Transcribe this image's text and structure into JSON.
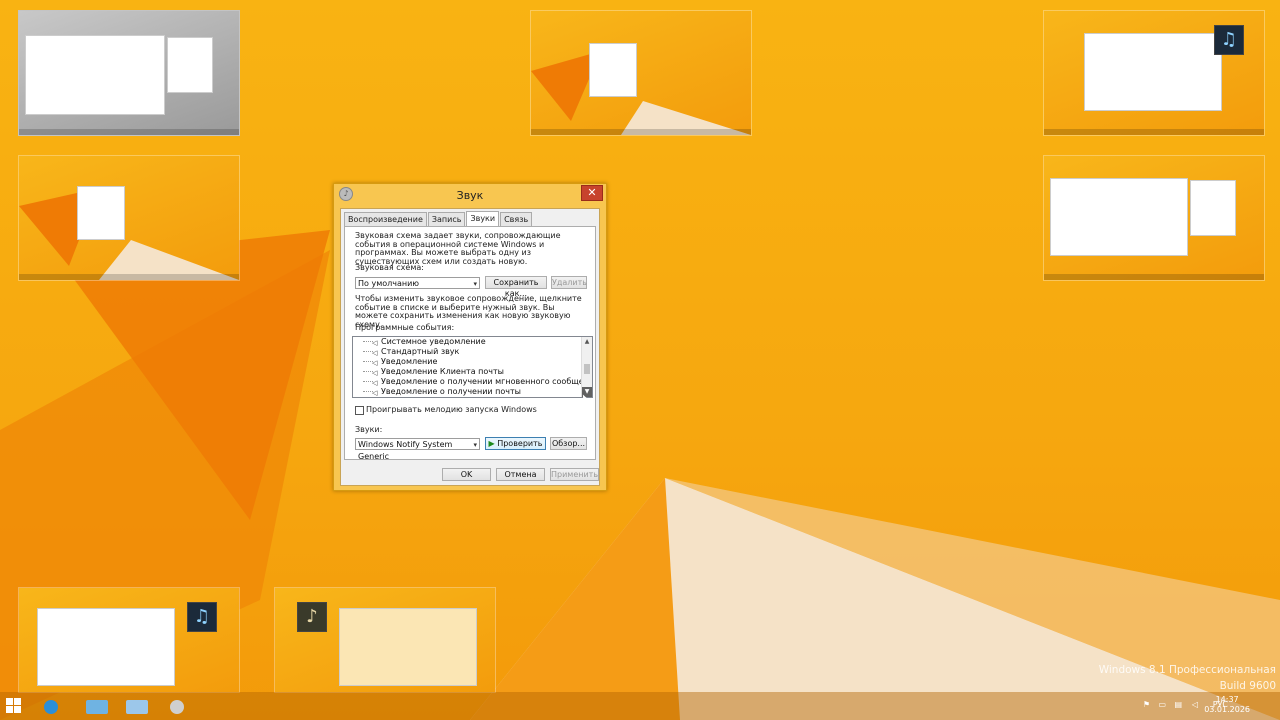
{
  "dialog": {
    "title": "Звук",
    "close_glyph": "✕",
    "tabs": [
      "Воспроизведение",
      "Запись",
      "Звуки",
      "Связь"
    ],
    "active_tab": "Звуки",
    "intro": "Звуковая схема задает звуки, сопровождающие события в операционной системе Windows и программах. Вы можете выбрать одну из существующих схем или создать новую.",
    "scheme_label": "Звуковая схема:",
    "scheme_value": "По умолчанию",
    "save_as": "Сохранить как...",
    "delete": "Удалить",
    "instruction": "Чтобы изменить звуковое сопровождение, щелкните событие в списке и выберите нужный звук. Вы можете сохранить изменения как новую звуковую схему.",
    "events_label": "Программные события:",
    "events": [
      "Системное уведомление",
      "Стандартный звук",
      "Уведомление",
      "Уведомление Клиента почты",
      "Уведомление о получении мгновенного сообщения",
      "Уведомление о получении почты"
    ],
    "startup_checkbox": "Проигрывать мелодию запуска Windows",
    "sounds_label": "Звуки:",
    "sound_value": "Windows Notify System Generic",
    "test": "Проверить",
    "browse": "Обзор...",
    "ok": "OK",
    "cancel": "Отмена",
    "apply": "Применить"
  },
  "watermark": {
    "edition": "Windows 8.1 Профессиональная",
    "build": "Build 9600"
  },
  "taskbar": {
    "lang": "РУС",
    "time": "14:37",
    "date": "03.01.2026"
  },
  "icons": {
    "start": "windows-start-icon",
    "scroll_up": "▲",
    "scroll_down": "▼",
    "combo_arrow": "▾",
    "speaker": "◁",
    "test_play": "▶"
  },
  "colors": {
    "desktop": "#f7a60d",
    "dialog_frame": "#f8c650",
    "close": "#c7432d"
  }
}
